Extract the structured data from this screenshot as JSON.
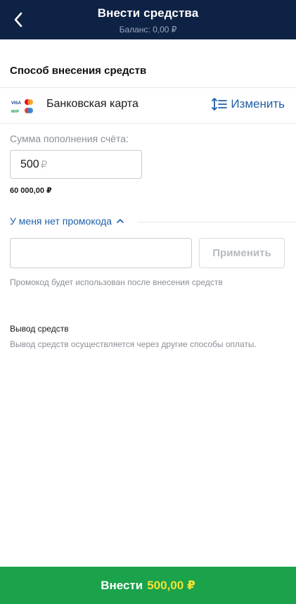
{
  "header": {
    "title": "Внести средства",
    "balance": "Баланс: 0,00 ₽"
  },
  "payment_method": {
    "section_title": "Способ внесения средств",
    "label": "Банковская карта",
    "change_label": "Изменить",
    "card_logo_texts": [
      "VISA",
      "МИР"
    ]
  },
  "amount": {
    "label": "Сумма пополнения счёта:",
    "value": "500",
    "currency": "₽",
    "max": "60 000,00 ₽"
  },
  "promo": {
    "toggle_label": "У меня нет промокода",
    "input_value": "",
    "apply_label": "Применить",
    "note": "Промокод будет использован после внесения средств"
  },
  "withdraw": {
    "title": "Вывод средств",
    "description": "Вывод средств осуществляется через другие способы оплаты."
  },
  "submit": {
    "label": "Внести",
    "amount": "500,00 ₽"
  },
  "colors": {
    "header_bg": "#0e2245",
    "link": "#1f5fa8",
    "submit_bg": "#1aa34a",
    "submit_amount": "#f3e332"
  }
}
